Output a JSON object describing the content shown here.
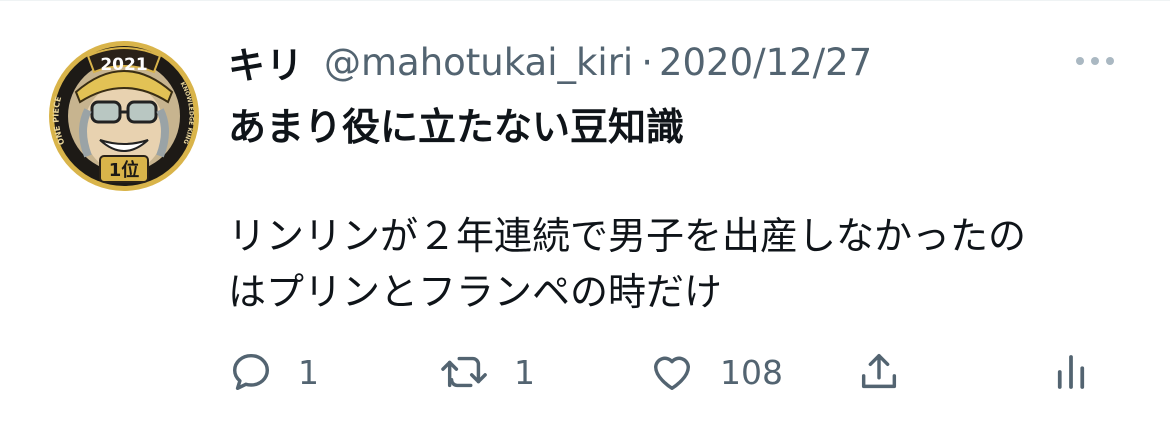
{
  "tweet": {
    "author": {
      "display_name": "キリ",
      "handle": "@mahotukai_kiri",
      "avatar": {
        "badge_year": "2021",
        "badge_rank": "1位",
        "ring_text_left": "ONE PIECE",
        "ring_text_right": "KNOWLEDGE KING"
      }
    },
    "separator": "·",
    "timestamp": "2020/12/27",
    "title": "あまり役に立たない豆知識",
    "body_lines": [
      "リンリンが２年連続で男子を出産しなかったの",
      "はプリンとフランペの時だけ"
    ],
    "actions": {
      "reply": {
        "icon": "reply-icon",
        "count": "1"
      },
      "retweet": {
        "icon": "retweet-icon",
        "count": "1"
      },
      "like": {
        "icon": "heart-icon",
        "count": "108"
      },
      "share": {
        "icon": "share-icon"
      },
      "analytics": {
        "icon": "analytics-icon"
      }
    },
    "more_icon": "more-icon"
  },
  "colors": {
    "text_primary": "#0f1419",
    "text_secondary": "#536471",
    "background": "#ffffff",
    "badge_gold": "#c9a13a"
  }
}
